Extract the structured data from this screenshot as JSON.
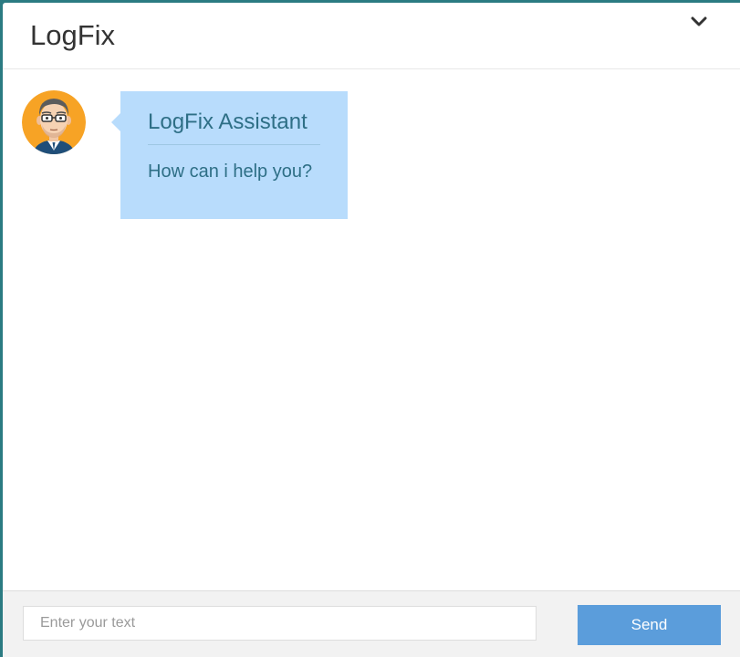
{
  "header": {
    "title": "LogFix",
    "collapse_icon": "chevron-down-icon"
  },
  "messages": [
    {
      "sender": "LogFix Assistant",
      "text": "How can i help you?",
      "avatar_icon": "avatar-icon"
    }
  ],
  "composer": {
    "placeholder": "Enter your text",
    "value": "",
    "send_label": "Send"
  },
  "colors": {
    "frame": "#2b7b82",
    "bubble": "#b8dcfc",
    "bubble_text": "#2e6f86",
    "send_button": "#5b9ddb"
  }
}
